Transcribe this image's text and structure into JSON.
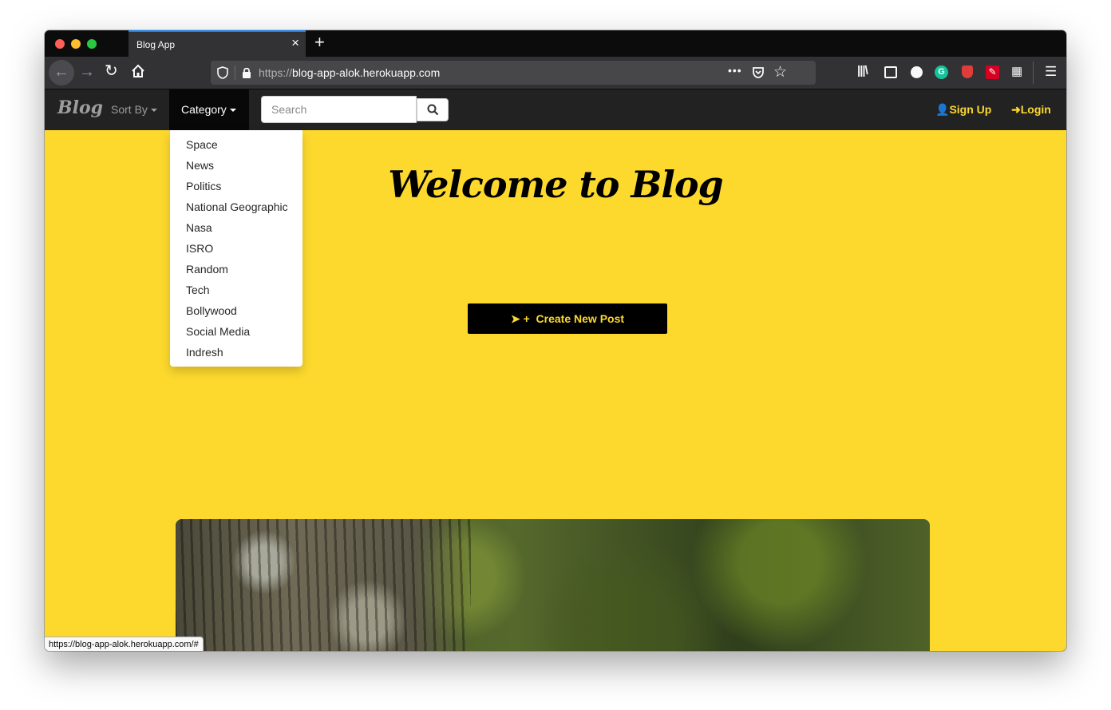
{
  "browser": {
    "tab_title": "Blog App",
    "tab_close": "×",
    "new_tab": "+",
    "url_scheme": "https://",
    "url_host": "blog-app-alok.herokuapp.com",
    "page_actions": "•••",
    "status_url": "https://blog-app-alok.herokuapp.com/#",
    "icons": [
      "back-arrow-icon",
      "forward-arrow-icon",
      "reload-icon",
      "home-icon",
      "shield-icon",
      "lock-icon",
      "more-icon",
      "pocket-icon",
      "bookmark-star-icon",
      "library-icon",
      "sidebar-icon",
      "account-icon",
      "grammarly-icon",
      "ublock-icon",
      "extension-icon",
      "grid-extension-icon",
      "hamburger-menu-icon"
    ]
  },
  "navbar": {
    "brand": "Blog",
    "sort_by": "Sort By",
    "category": "Category",
    "search_placeholder": "Search",
    "sign_up": "Sign Up",
    "login": "Login"
  },
  "dropdown": {
    "items": [
      "Space",
      "News",
      "Politics",
      "National Geographic",
      "Nasa",
      "ISRO",
      "Random",
      "Tech",
      "Bollywood",
      "Social Media",
      "Indresh"
    ]
  },
  "hero": {
    "title": "Welcome to Blog",
    "create_button": "Create New Post"
  },
  "colors": {
    "page_background": "#fdd92d",
    "navbar": "#222222",
    "accent": "#fdd92d",
    "button": "#000000"
  }
}
